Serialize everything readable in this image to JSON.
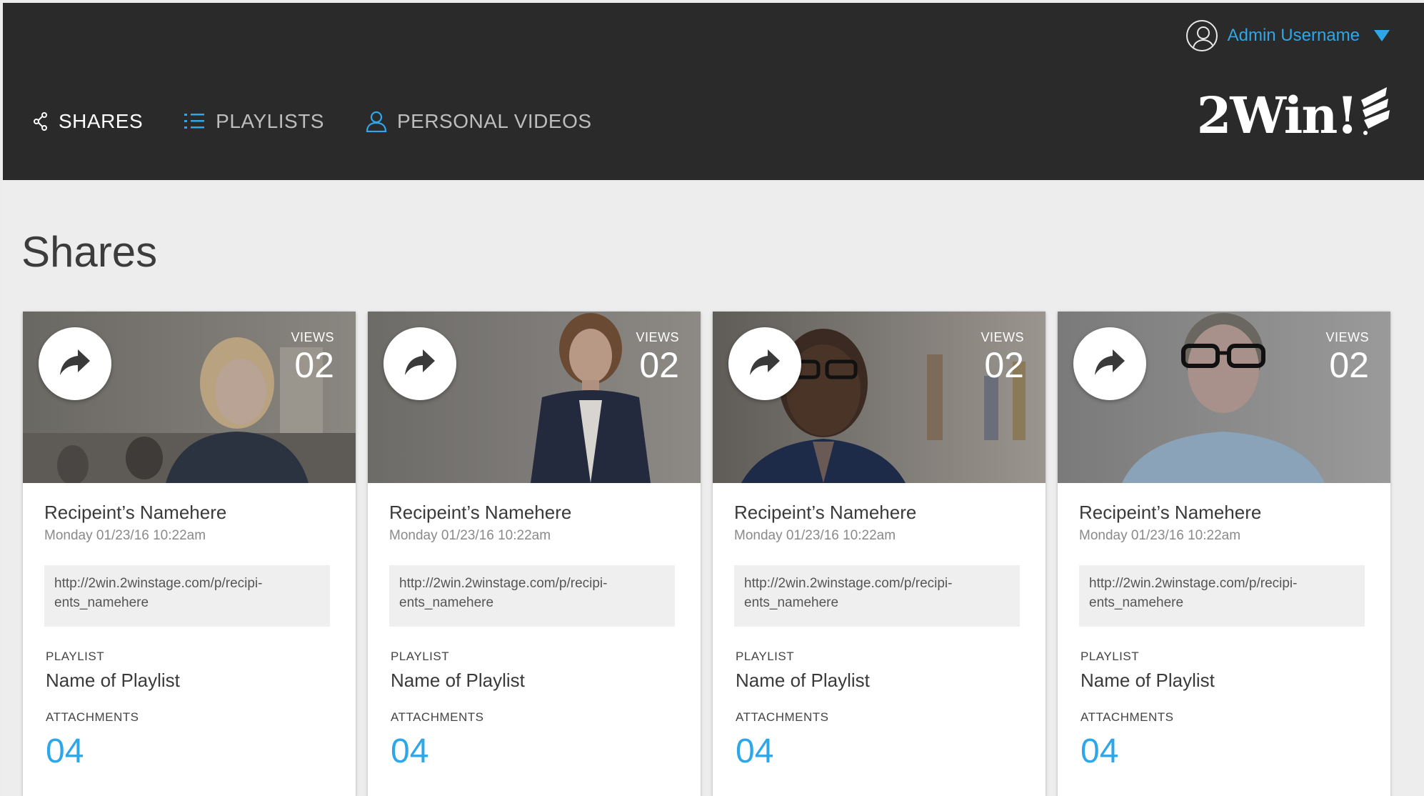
{
  "user": {
    "name": "Admin Username"
  },
  "nav": {
    "shares": "SHARES",
    "playlists": "PLAYLISTS",
    "personal_videos": "PERSONAL VIDEOS"
  },
  "logo": {
    "text": "2Win!"
  },
  "page": {
    "title": "Shares"
  },
  "colors": {
    "accent": "#2ea7e8",
    "topbar": "#2a2a2a",
    "background": "#ededed"
  },
  "cards": [
    {
      "views_label": "VIEWS",
      "views": "02",
      "recipient": "Recipeint’s Namehere",
      "timestamp": "Monday 01/23/16 10:22am",
      "url_line1": "http://2win.2winstage.com/p/recipi-",
      "url_line2": "ents_namehere",
      "playlist_label": "PLAYLIST",
      "playlist": "Name of Playlist",
      "attachments_label": "ATTACHMENTS",
      "attachments": "04"
    },
    {
      "views_label": "VIEWS",
      "views": "02",
      "recipient": "Recipeint’s Namehere",
      "timestamp": "Monday 01/23/16 10:22am",
      "url_line1": "http://2win.2winstage.com/p/recipi-",
      "url_line2": "ents_namehere",
      "playlist_label": "PLAYLIST",
      "playlist": "Name of Playlist",
      "attachments_label": "ATTACHMENTS",
      "attachments": "04"
    },
    {
      "views_label": "VIEWS",
      "views": "02",
      "recipient": "Recipeint’s Namehere",
      "timestamp": "Monday 01/23/16 10:22am",
      "url_line1": "http://2win.2winstage.com/p/recipi-",
      "url_line2": "ents_namehere",
      "playlist_label": "PLAYLIST",
      "playlist": "Name of Playlist",
      "attachments_label": "ATTACHMENTS",
      "attachments": "04"
    },
    {
      "views_label": "VIEWS",
      "views": "02",
      "recipient": "Recipeint’s Namehere",
      "timestamp": "Monday 01/23/16 10:22am",
      "url_line1": "http://2win.2winstage.com/p/recipi-",
      "url_line2": "ents_namehere",
      "playlist_label": "PLAYLIST",
      "playlist": "Name of Playlist",
      "attachments_label": "ATTACHMENTS",
      "attachments": "04"
    }
  ]
}
